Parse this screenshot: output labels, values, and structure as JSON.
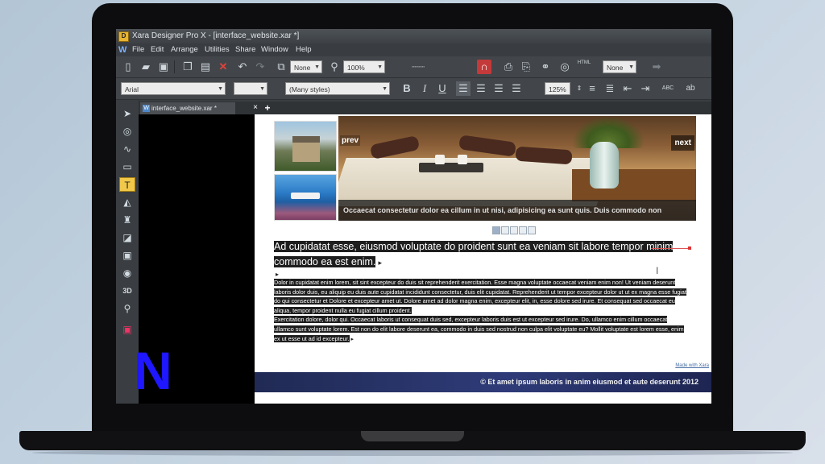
{
  "window": {
    "title": "Xara Designer Pro X - [interface_website.xar *]",
    "app_icon": "D"
  },
  "menu": {
    "logo": "W",
    "items": [
      "File",
      "Edit",
      "Arrange",
      "Utilities",
      "Share",
      "Window",
      "Help"
    ]
  },
  "toolbar_top": {
    "zoom_fit": "None",
    "zoom": "100%",
    "quality": "None",
    "html_label": "HTML"
  },
  "toolbar_text": {
    "font": "Arial",
    "size": "",
    "style": "(Many styles)",
    "bold": "B",
    "italic": "I",
    "underline": "U",
    "zoom_pct": "125%",
    "abc": "ABC"
  },
  "toolbox": {
    "icons": [
      "selector-tool-icon",
      "contour-tool-icon",
      "shape-editor-tool-icon",
      "rectangle-tool-icon",
      "text-tool-icon",
      "fill-tool-icon",
      "transparency-tool-icon",
      "shadow-tool-icon",
      "bevel-tool-icon",
      "blend-tool-icon",
      "extrude-tool-icon",
      "zoom-tool-icon",
      "photo-tool-icon"
    ],
    "extrude_label": "3D"
  },
  "document_tab": {
    "label": "interface_website.xar *",
    "close": "×",
    "add": "+"
  },
  "page": {
    "prev": "prev",
    "next": "next",
    "caption": "Occaecat consectetur dolor ea cillum in ut nisi, adipisicing ea sunt quis. Duis commodo non",
    "heading": "Ad cupidatat esse, eiusmod voluptate do proident sunt ea veniam sit labore tempor minim commodo ea est enim.",
    "paragraph1": "Dolor in cupidatat enim lorem, sit sint excepteur do duis sit reprehenderit exercitation. Esse magna voluptate occaecat veniam enim non! Ut veniam deserunt laboris dolor duis, eu aliquip eu duis aute cupidatat incididunt consectetur, duis elit cupidatat. Reprehenderit ut tempor excepteur dolor ut ut ex magna esse fugiat do qui consectetur et Dolore et excepteur amet ut. Dolore amet ad dolor magna enim, excepteur elit, in, esse dolore sed irure. Et consequat sed occaecat eu aliqua, tempor proident nulla eu fugiat cillum proident.",
    "paragraph2": "Exercitation dolore, dolor qui. Occaecat laboris ut consequat duis sed, excepteur laboris duis est ut excepteur sed irure. Do, ullamco enim cillum occaecat ullamco sunt voluptate lorem. Est non do elit labore deserunt ea, commodo in duis sed nostrud non culpa elit voluptate eu? Mollit voluptate est lorem esse, enim ex ut esse ut ad id excepteur.",
    "made_with": "Made with Xara",
    "footer": "© Et amet ipsum laboris in anim eiusmod et aute deserunt 2012",
    "slide_dots": 5,
    "active_dot": 1
  },
  "brand": {
    "letter": "N",
    "color": "#1e17ff"
  }
}
